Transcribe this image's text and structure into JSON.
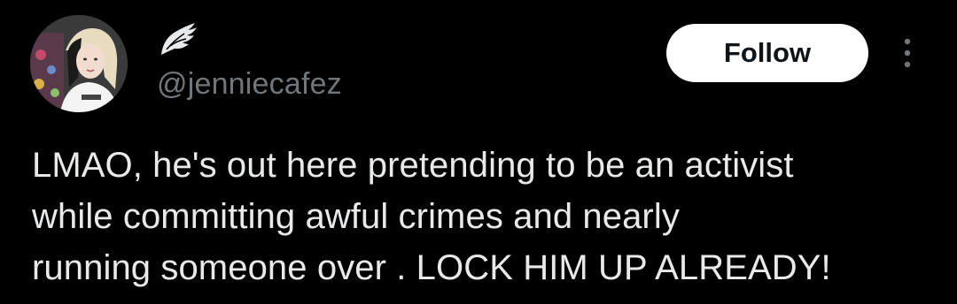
{
  "tweet": {
    "author": {
      "handle": "@jenniecafez",
      "avatar_icon": "profile-photo",
      "name_badge_icon": "angel-wing-icon"
    },
    "follow_label": "Follow",
    "more_icon": "more-vertical-icon",
    "text": "LMAO, he's out here pretending to be an activist\nwhile committing awful crimes and nearly\nrunning someone over . LOCK HIM UP ALREADY!"
  },
  "colors": {
    "background": "#000000",
    "text": "#e7e9ea",
    "secondary_text": "#71767b",
    "follow_button_bg": "#ffffff",
    "follow_button_text": "#0f1419"
  }
}
